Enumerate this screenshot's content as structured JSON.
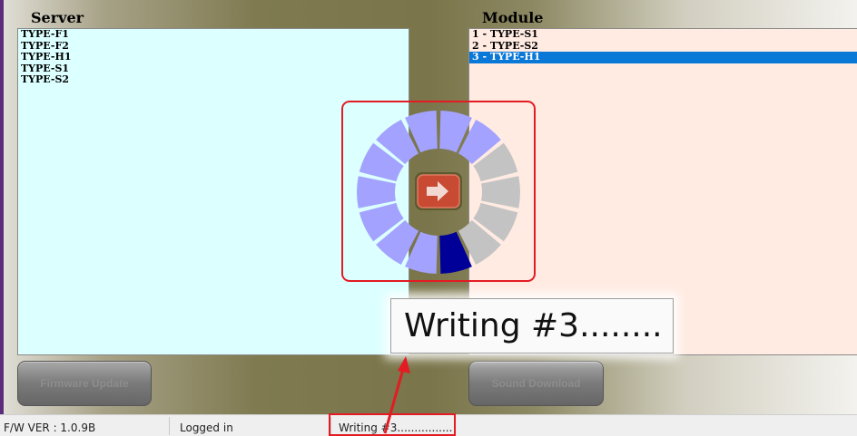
{
  "server": {
    "title": "Server",
    "items": [
      "TYPE-F1",
      "TYPE-F2",
      "TYPE-H1",
      "TYPE-S1",
      "TYPE-S2"
    ]
  },
  "module": {
    "title": "Module",
    "items": [
      "1 - TYPE-S1",
      "2 - TYPE-S2",
      "3 - TYPE-H1"
    ],
    "selected_index": 2
  },
  "buttons": {
    "firmware_update": "Firmware Update",
    "sound_download": "Sound Download"
  },
  "progress": {
    "segments_total": 14,
    "segment_colors": [
      "#a3a3ff",
      "#a3a3ff",
      "#c3c3c3",
      "#c3c3c3",
      "#c3c3c3",
      "#c3c3c3",
      "#000099",
      "#a3a3ff",
      "#a3a3ff",
      "#a3a3ff",
      "#a3a3ff",
      "#a3a3ff",
      "#a3a3ff",
      "#a3a3ff"
    ],
    "active_color": "#000099",
    "done_color": "#a3a3ff",
    "pending_color": "#c3c3c3",
    "center_icon": "arrow-right-icon"
  },
  "tooltip": {
    "text": "Writing #3........"
  },
  "statusbar": {
    "fw_version": "F/W VER : 1.0.9B",
    "login_status": "Logged in",
    "task_status": "Writing #3................"
  },
  "annotation_color": "#e31b23"
}
